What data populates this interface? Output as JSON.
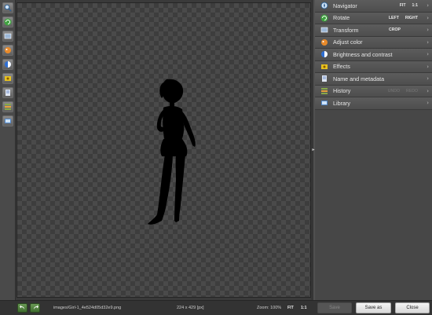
{
  "toolbar": {
    "tools": [
      {
        "icon": "zoom-icon",
        "color": "#8fb3d9"
      },
      {
        "icon": "rotate-icon",
        "color": "#3fa33f"
      },
      {
        "icon": "transform-icon",
        "color": "#9cb7d6"
      },
      {
        "icon": "adjust-color-icon",
        "color": "#e88a2a"
      },
      {
        "icon": "brightness-contrast-icon",
        "color": "#2f6fd3"
      },
      {
        "icon": "effects-icon",
        "color": "#e7c21f"
      },
      {
        "icon": "name-metadata-icon",
        "color": "#6f8fc9"
      },
      {
        "icon": "history-icon",
        "color": "#8aa848"
      },
      {
        "icon": "library-icon",
        "color": "#4f86c9"
      }
    ]
  },
  "panel": {
    "rows": [
      {
        "label": "Navigator",
        "icon": "navigator-icon",
        "options": [
          {
            "text": "FIT",
            "enabled": true
          },
          {
            "text": "1:1",
            "enabled": true
          }
        ]
      },
      {
        "label": "Rotate",
        "icon": "rotate-icon",
        "options": [
          {
            "text": "LEFT",
            "enabled": true
          },
          {
            "text": "RIGHT",
            "enabled": true
          }
        ]
      },
      {
        "label": "Transform",
        "icon": "transform-icon",
        "options": [
          {
            "text": "CROP",
            "enabled": true
          }
        ]
      },
      {
        "label": "Adjust color",
        "icon": "adjust-color-icon",
        "options": []
      },
      {
        "label": "Brightness and contrast",
        "icon": "brightness-contrast-icon",
        "options": []
      },
      {
        "label": "Effects",
        "icon": "effects-icon",
        "options": []
      },
      {
        "label": "Name and metadata",
        "icon": "name-metadata-icon",
        "options": []
      },
      {
        "label": "History",
        "icon": "history-icon",
        "options": [
          {
            "text": "UNDO",
            "enabled": false
          },
          {
            "text": "REDO",
            "enabled": false
          }
        ]
      },
      {
        "label": "Library",
        "icon": "library-icon",
        "options": []
      }
    ]
  },
  "status": {
    "filename": "images/Girl-1_4e524d05d32e9.png",
    "dimensions": "224 x 429 [px]",
    "zoom_label": "Zoom: 100%",
    "fit": "FIT",
    "one_to_one": "1:1"
  },
  "buttons": {
    "save": "Save",
    "save_as": "Save as",
    "close": "Close"
  }
}
